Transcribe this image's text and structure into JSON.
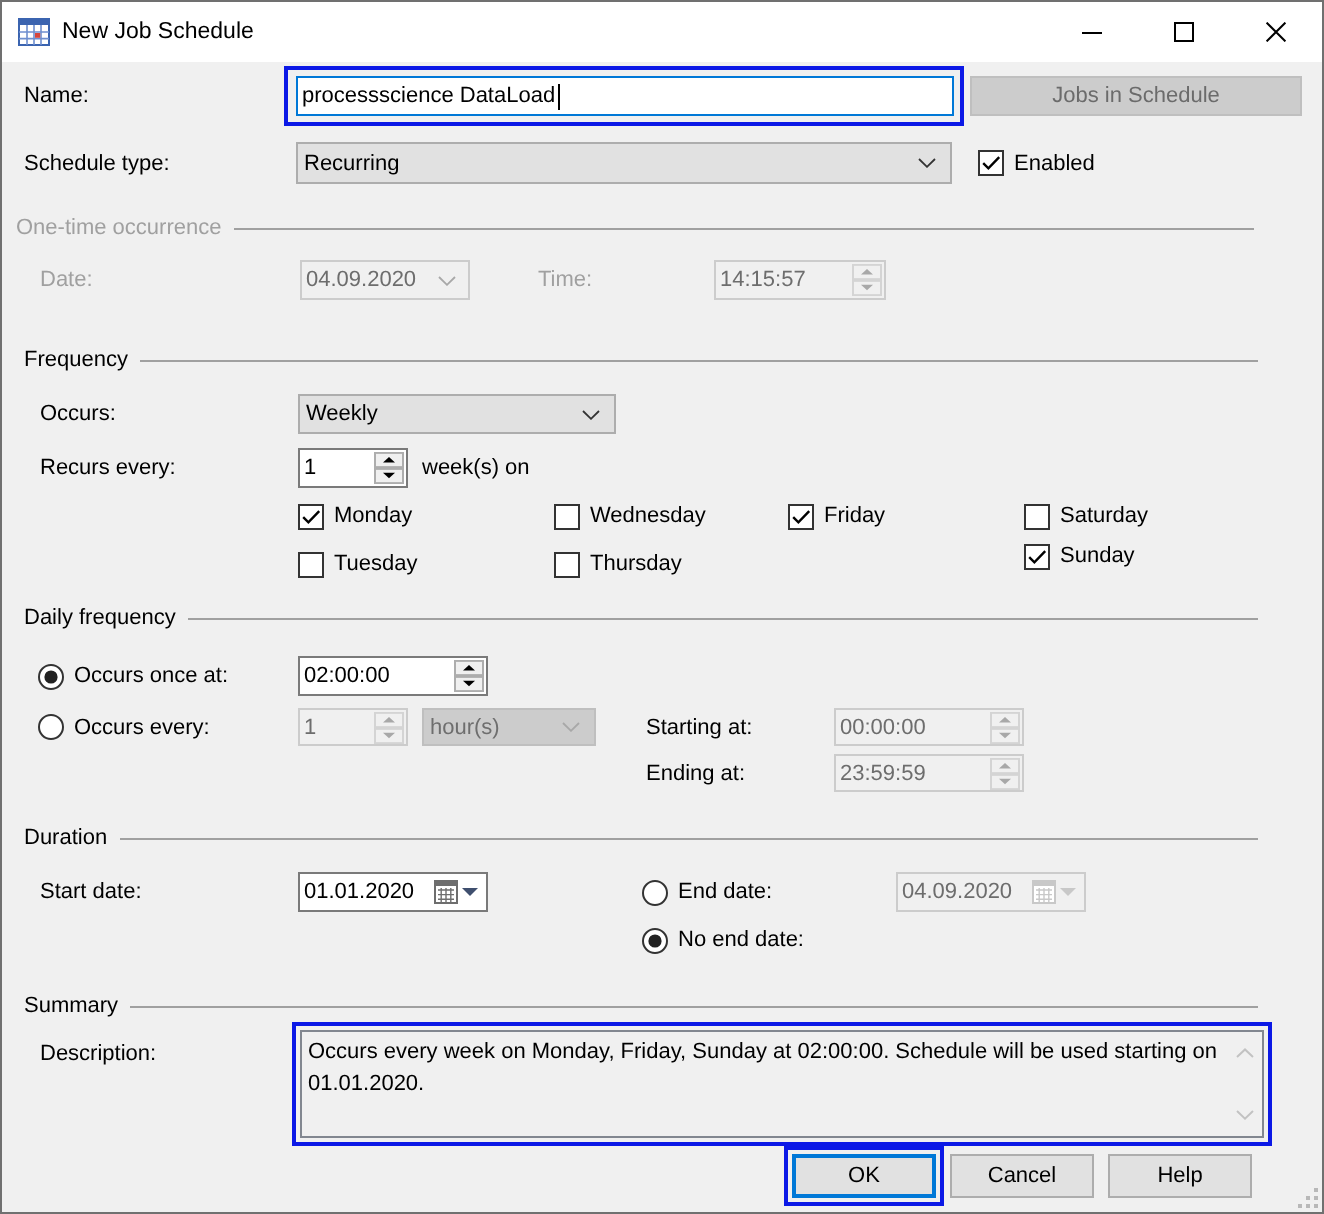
{
  "window": {
    "title": "New Job Schedule"
  },
  "name": {
    "label": "Name:",
    "value": "processscience DataLoad",
    "highlighted": true
  },
  "jobs_in_schedule_button": {
    "label": "Jobs in Schedule",
    "disabled": true
  },
  "schedule_type": {
    "label": "Schedule type:",
    "value": "Recurring"
  },
  "enabled": {
    "label": "Enabled",
    "checked": true
  },
  "one_time_occurrence": {
    "title": "One-time occurrence",
    "disabled": true,
    "date": {
      "label": "Date:",
      "value": "04.09.2020"
    },
    "time": {
      "label": "Time:",
      "value": "14:15:57"
    }
  },
  "frequency": {
    "title": "Frequency",
    "occurs": {
      "label": "Occurs:",
      "value": "Weekly"
    },
    "recurs_every": {
      "label": "Recurs every:",
      "value": "1",
      "unit": "week(s) on"
    },
    "day_columns": [
      [
        {
          "label": "Monday",
          "checked": true
        },
        {
          "label": "Tuesday",
          "checked": false
        }
      ],
      [
        {
          "label": "Wednesday",
          "checked": false
        },
        {
          "label": "Thursday",
          "checked": false
        }
      ],
      [
        {
          "label": "Friday",
          "checked": true
        }
      ],
      [
        {
          "label": "Saturday",
          "checked": false
        },
        {
          "label": "Sunday",
          "checked": true
        }
      ]
    ]
  },
  "daily_frequency": {
    "title": "Daily frequency",
    "occurs_once": {
      "label": "Occurs once at:",
      "selected": true,
      "value": "02:00:00"
    },
    "occurs_every": {
      "label": "Occurs every:",
      "selected": false,
      "value": "1",
      "unit": "hour(s)"
    },
    "starting_at": {
      "label": "Starting at:",
      "value": "00:00:00"
    },
    "ending_at": {
      "label": "Ending at:",
      "value": "23:59:59"
    }
  },
  "duration": {
    "title": "Duration",
    "start_date": {
      "label": "Start date:",
      "value": "01.01.2020"
    },
    "end_date": {
      "label": "End date:",
      "selected": false,
      "value": "04.09.2020"
    },
    "no_end_date": {
      "label": "No end date:",
      "selected": true
    }
  },
  "summary": {
    "title": "Summary",
    "description": {
      "label": "Description:",
      "value": "Occurs every week on Monday, Friday, Sunday at 02:00:00. Schedule will be used starting on 01.01.2020.",
      "highlighted": true
    }
  },
  "buttons": [
    {
      "label": "OK",
      "default": true,
      "highlighted": true
    },
    {
      "label": "Cancel",
      "default": false,
      "highlighted": false
    },
    {
      "label": "Help",
      "default": false,
      "highlighted": false
    }
  ]
}
